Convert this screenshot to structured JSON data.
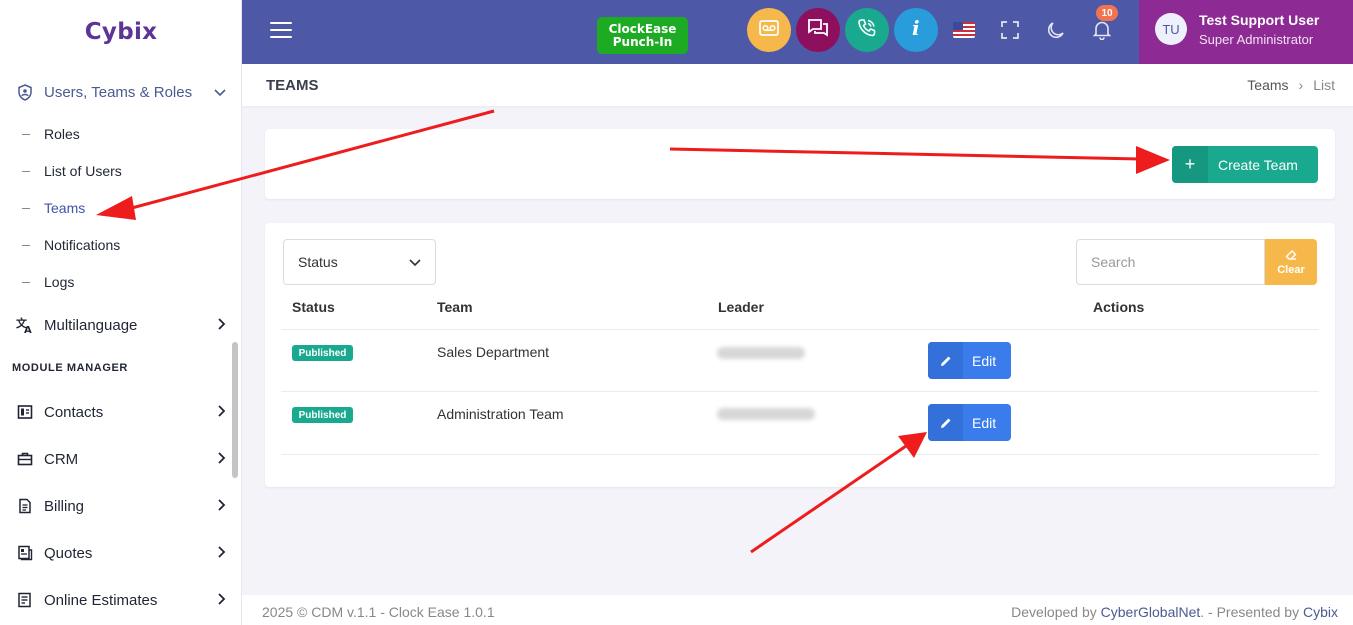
{
  "app": {
    "logo": "Cybix"
  },
  "sidebar": {
    "group": {
      "label": "Users, Teams & Roles",
      "icon": "shield-user-icon"
    },
    "sub_items": [
      {
        "label": "Roles"
      },
      {
        "label": "List of Users"
      },
      {
        "label": "Teams",
        "active": true
      },
      {
        "label": "Notifications"
      },
      {
        "label": "Logs"
      }
    ],
    "multilanguage": {
      "label": "Multilanguage",
      "icon": "translate-icon"
    },
    "section_title": "MODULE MANAGER",
    "modules": [
      {
        "label": "Contacts",
        "icon": "contacts-icon"
      },
      {
        "label": "CRM",
        "icon": "briefcase-icon"
      },
      {
        "label": "Billing",
        "icon": "billing-icon"
      },
      {
        "label": "Quotes",
        "icon": "quotes-icon"
      },
      {
        "label": "Online Estimates",
        "icon": "estimates-icon"
      }
    ]
  },
  "header": {
    "clockease_line1": "ClockEase",
    "clockease_line2": "Punch-In",
    "notification_count": "10",
    "user": {
      "initials": "TU",
      "name": "Test Support User",
      "role": "Super Administrator"
    },
    "colors": {
      "voicemail": "#f7b84b",
      "chat": "#8d0f5e",
      "calls": "#19a98e",
      "info": "#299cdb"
    }
  },
  "page": {
    "title": "TEAMS",
    "breadcrumb": {
      "parent": "Teams",
      "current": "List"
    }
  },
  "toolbar": {
    "create_label": "Create Team"
  },
  "filters": {
    "status_label": "Status",
    "search_placeholder": "Search",
    "clear_label": "Clear"
  },
  "table": {
    "headers": {
      "status": "Status",
      "team": "Team",
      "leader": "Leader",
      "actions": "Actions"
    },
    "rows": [
      {
        "status": "Published",
        "team": "Sales Department",
        "edit": "Edit"
      },
      {
        "status": "Published",
        "team": "Administration Team",
        "edit": "Edit"
      }
    ]
  },
  "footer": {
    "left": "2025 © CDM v.1.1 - Clock Ease 1.0.1",
    "developed_by": "Developed by",
    "developer": "CyberGlobalNet",
    "presented_by": ". - Presented by",
    "presenter": "Cybix"
  }
}
